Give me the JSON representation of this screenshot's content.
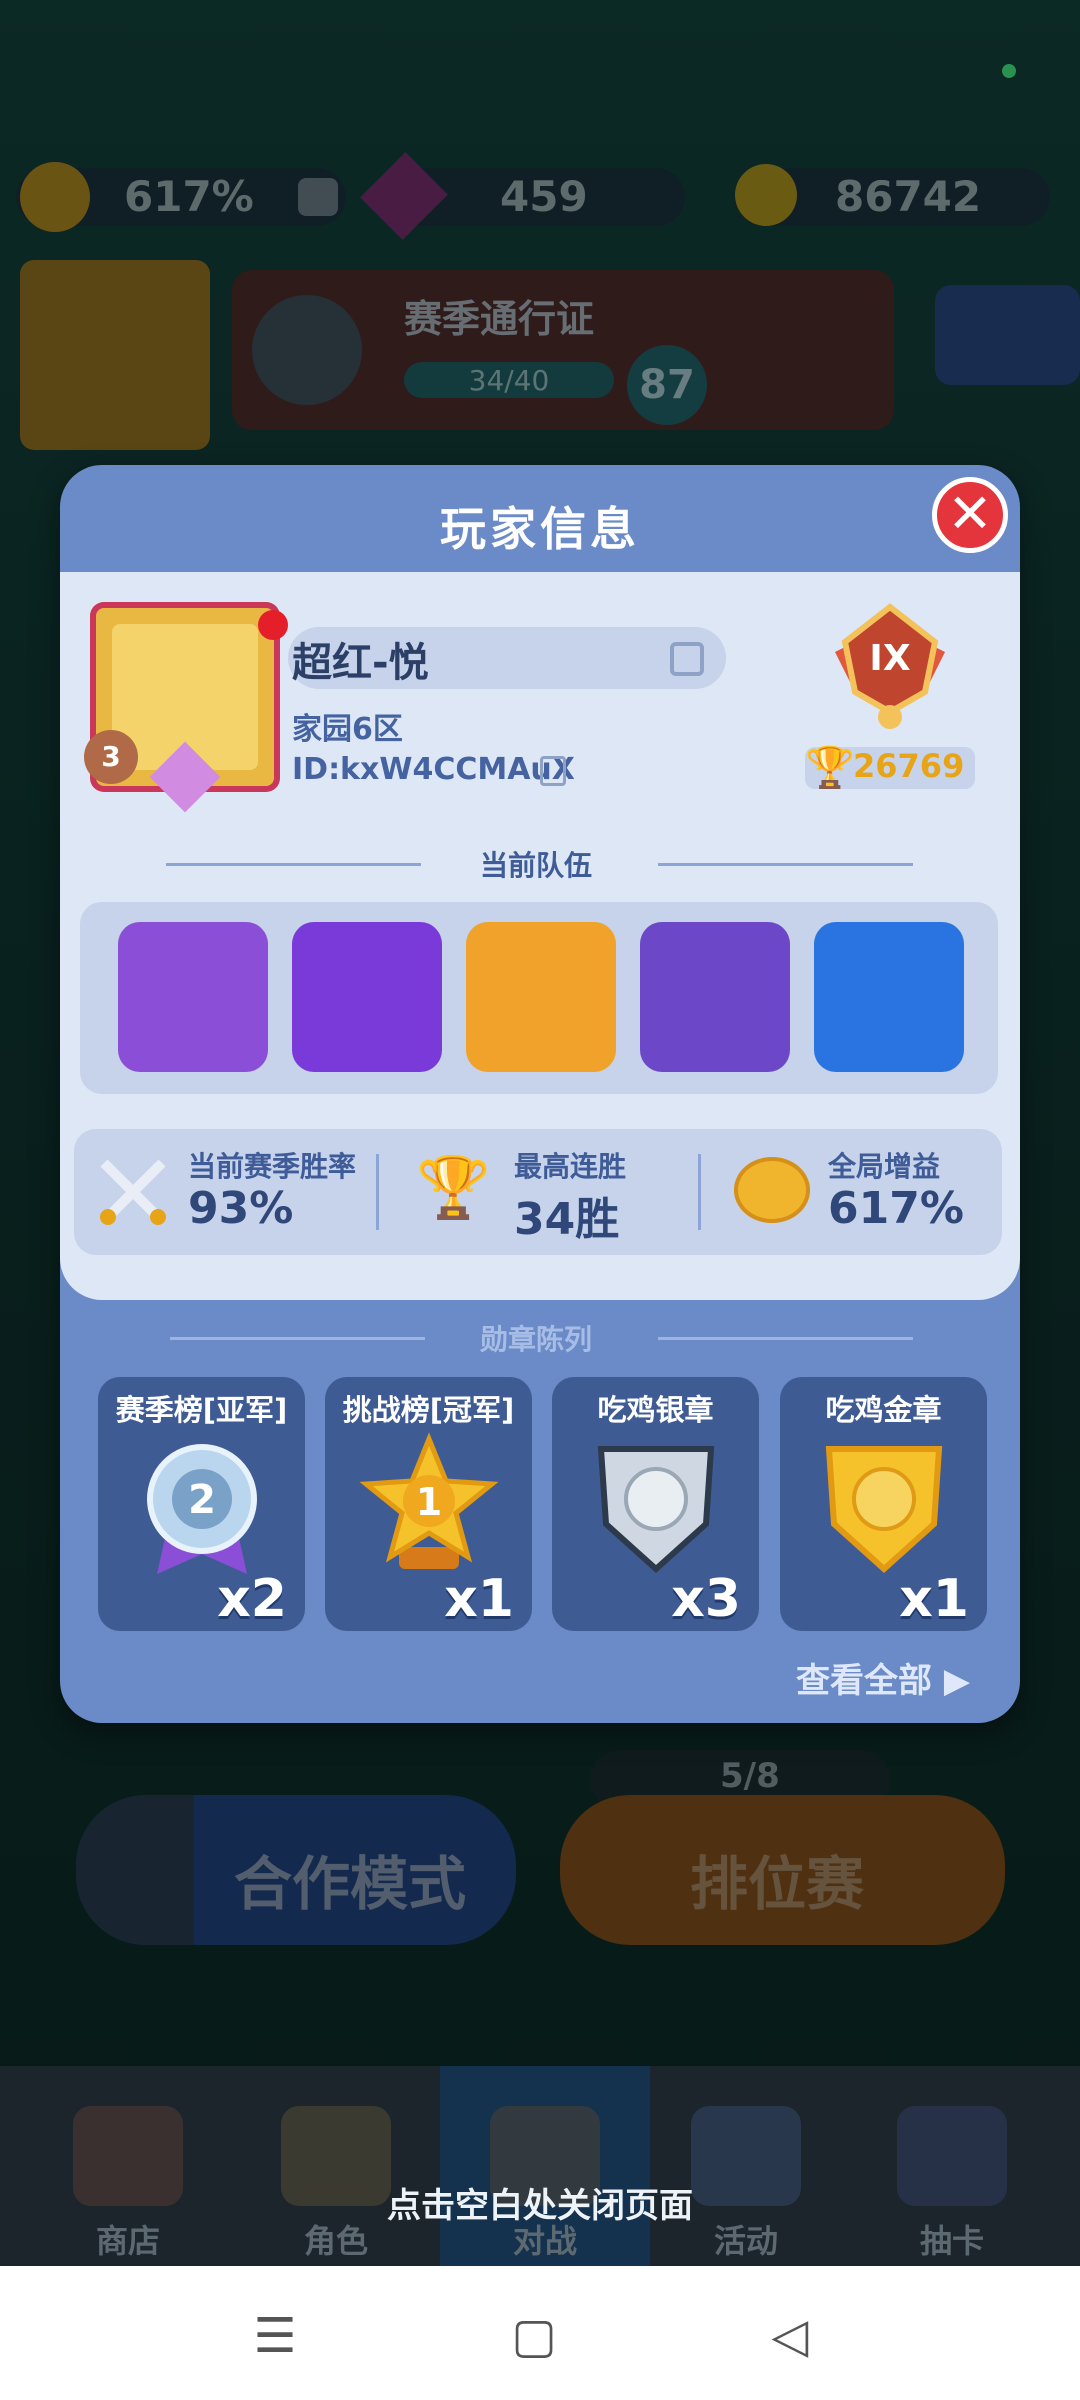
{
  "top_bar": {
    "boost_pct": "617%",
    "gems": "459",
    "coins": "86742"
  },
  "season_pass": {
    "title": "赛季通行证",
    "progress": "34/40",
    "level": "87"
  },
  "avatar_level": "3",
  "modal": {
    "title": "玩家信息",
    "player": {
      "name": "超红-悦",
      "region": "家园6区",
      "id": "ID:kxW4CCMAuX",
      "avatar_level": "3",
      "rank": "IX",
      "trophies": "26769"
    },
    "team_section_label": "当前队伍",
    "team": [
      {
        "name": "hero-1",
        "color": "#8a4fd6"
      },
      {
        "name": "hero-2",
        "color": "#7a3ad9"
      },
      {
        "name": "hero-3",
        "color": "#f0a22a"
      },
      {
        "name": "hero-4",
        "color": "#6c48c9"
      },
      {
        "name": "hero-5",
        "color": "#2a74e2"
      }
    ],
    "stats": {
      "win_rate_label": "当前赛季胜率",
      "win_rate": "93%",
      "streak_label": "最高连胜",
      "streak": "34胜",
      "boost_label": "全局增益",
      "boost": "617%"
    },
    "medals_section_label": "勋章陈列",
    "medals": [
      {
        "name": "赛季榜[亚军]",
        "count": "x2",
        "badge": "2"
      },
      {
        "name": "挑战榜[冠军]",
        "count": "x1",
        "badge": "1"
      },
      {
        "name": "吃鸡银章",
        "count": "x3"
      },
      {
        "name": "吃鸡金章",
        "count": "x1"
      }
    ],
    "view_all": "查看全部"
  },
  "background": {
    "coop_mode": "合作模式",
    "ranked": "排位赛",
    "ranked_progress": "5/8"
  },
  "bottom_nav": {
    "items": [
      "商店",
      "角色",
      "对战",
      "活动",
      "抽卡"
    ]
  },
  "close_hint": "点击空白处关闭页面"
}
